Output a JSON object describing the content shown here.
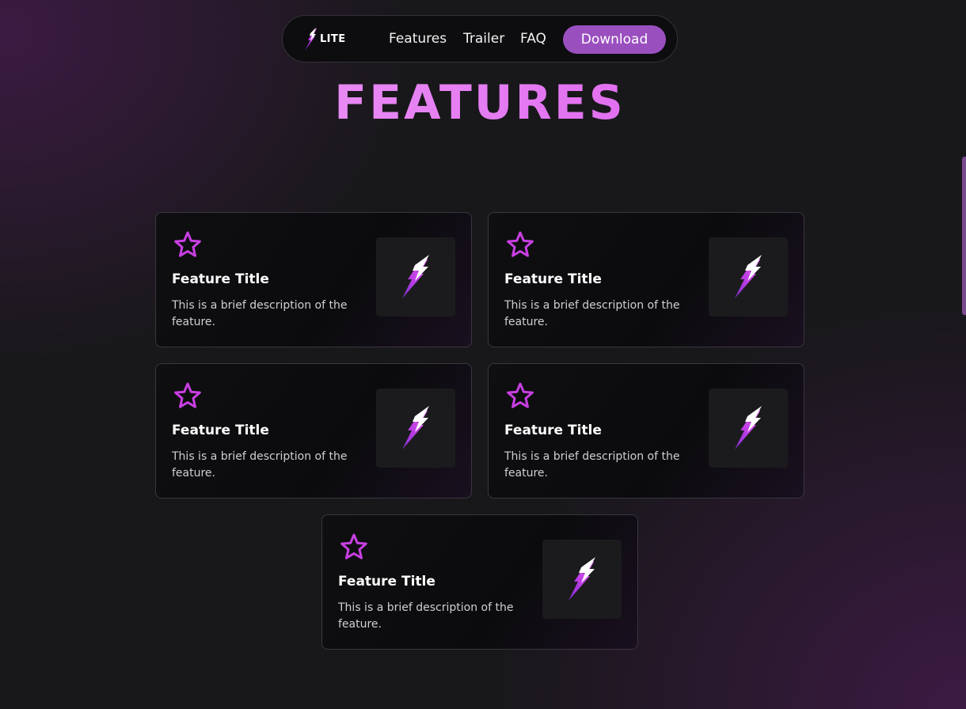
{
  "nav": {
    "logo_text": "LITE",
    "links": [
      {
        "label": "Features"
      },
      {
        "label": "Trailer"
      },
      {
        "label": "FAQ"
      }
    ],
    "download_label": "Download"
  },
  "page_title": "FEATURES",
  "icons": {
    "card_icon": "star-icon",
    "thumbnail_icon": "lightning-bolt-icon",
    "logo_icon": "lightning-bolt-icon"
  },
  "colors": {
    "accent": "#9a4fbf",
    "title_gradient_start": "#f0a4f6",
    "title_gradient_end": "#d84fec",
    "star": "#c93fe3",
    "background": "#18181a"
  },
  "features": [
    {
      "title": "Feature Title",
      "description": "This is a brief description of the feature."
    },
    {
      "title": "Feature Title",
      "description": "This is a brief description of the feature."
    },
    {
      "title": "Feature Title",
      "description": "This is a brief description of the feature."
    },
    {
      "title": "Feature Title",
      "description": "This is a brief description of the feature."
    },
    {
      "title": "Feature Title",
      "description": "This is a brief description of the feature."
    }
  ]
}
